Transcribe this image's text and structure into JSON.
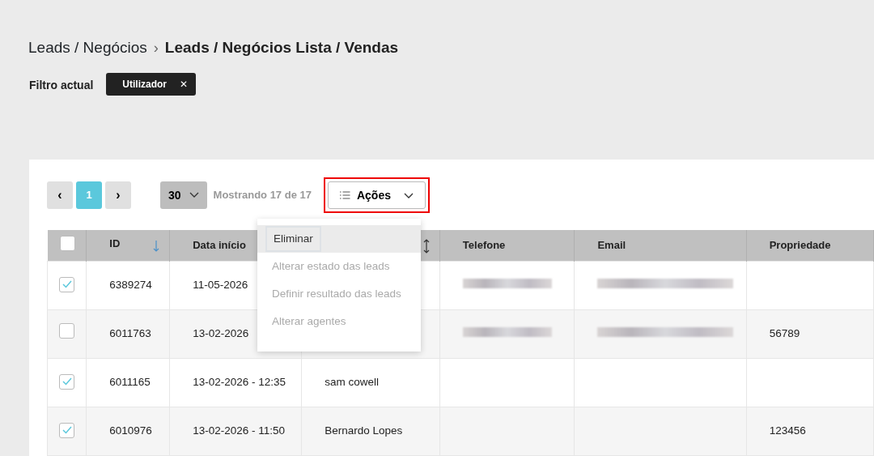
{
  "breadcrumb": {
    "parent": "Leads / Negócios",
    "separator": "›",
    "current": "Leads / Negócios Lista / Vendas"
  },
  "filter": {
    "label": "Filtro actual",
    "chips": [
      {
        "label": "Utilizador",
        "close": "✕"
      }
    ]
  },
  "pagination": {
    "prev": "‹",
    "next": "›",
    "pages": [
      {
        "label": "1",
        "selected": true
      }
    ]
  },
  "page_size": {
    "value": "30"
  },
  "showing": "Mostrando 17 de 17",
  "actions": {
    "label": "Ações",
    "highlighted": true,
    "menu": [
      {
        "label": "Eliminar",
        "disabled": false,
        "hovered": true,
        "highlighted": true
      },
      {
        "label": "Alterar estado das leads",
        "disabled": true,
        "hovered": false,
        "highlighted": false
      },
      {
        "label": "Definir resultado das leads",
        "disabled": true,
        "hovered": false,
        "highlighted": false
      },
      {
        "label": "Alterar agentes",
        "disabled": true,
        "hovered": false,
        "highlighted": false
      }
    ]
  },
  "table": {
    "header_checkbox": {
      "checked": false
    },
    "columns": [
      {
        "label": "ID",
        "kind": "sorted"
      },
      {
        "label": "Data início",
        "kind": "plain"
      },
      {
        "kind": "sortable"
      },
      {
        "label": "Telefone",
        "kind": "plain"
      },
      {
        "label": "Email",
        "kind": "plain"
      },
      {
        "label": "Propriedade",
        "kind": "plain"
      }
    ],
    "rows": [
      {
        "checked": true,
        "id": "6389274",
        "date": "11-05-2026",
        "phone_redacted": true,
        "email_redacted": true
      },
      {
        "checked": false,
        "id": "6011763",
        "date": "13-02-2026",
        "phone_redacted": true,
        "email_redacted": true,
        "property": "56789"
      },
      {
        "checked": true,
        "id": "6011165",
        "date": "13-02-2026 - 12:35",
        "column_4": "sam cowell",
        "phone_redacted": false,
        "email_redacted": false
      },
      {
        "checked": true,
        "id": "6010976",
        "date": "13-02-2026 - 11:50",
        "column_4": "Bernardo Lopes",
        "phone_redacted": false,
        "email_redacted": false,
        "property": "123456"
      }
    ]
  }
}
